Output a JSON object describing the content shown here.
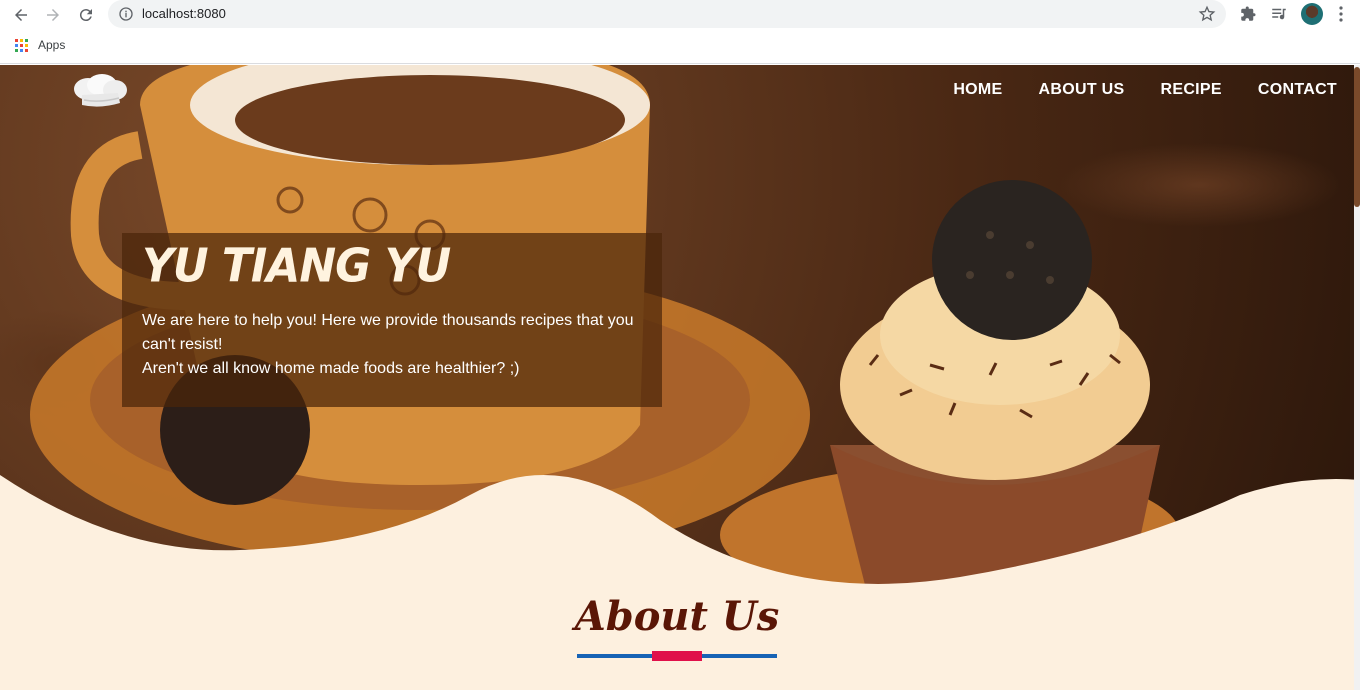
{
  "browser": {
    "url": "localhost:8080",
    "bookmarks": [
      {
        "label": "Apps",
        "icon": "apps-grid-icon"
      }
    ]
  },
  "site": {
    "nav": [
      {
        "label": "HOME"
      },
      {
        "label": "ABOUT US"
      },
      {
        "label": "RECIPE"
      },
      {
        "label": "CONTACT"
      }
    ],
    "hero": {
      "title": "YU TIANG YU",
      "line1": "We are here to help you! Here we provide thousands recipes that you can't resist!",
      "line2": "Aren't we all know home made foods are healthier? ;)"
    },
    "about": {
      "title": "About Us"
    },
    "colors": {
      "cream": "#fdf0df",
      "title_brown": "#5a1606",
      "underline_blue": "#1763b5",
      "underline_red": "#e0104a"
    }
  }
}
